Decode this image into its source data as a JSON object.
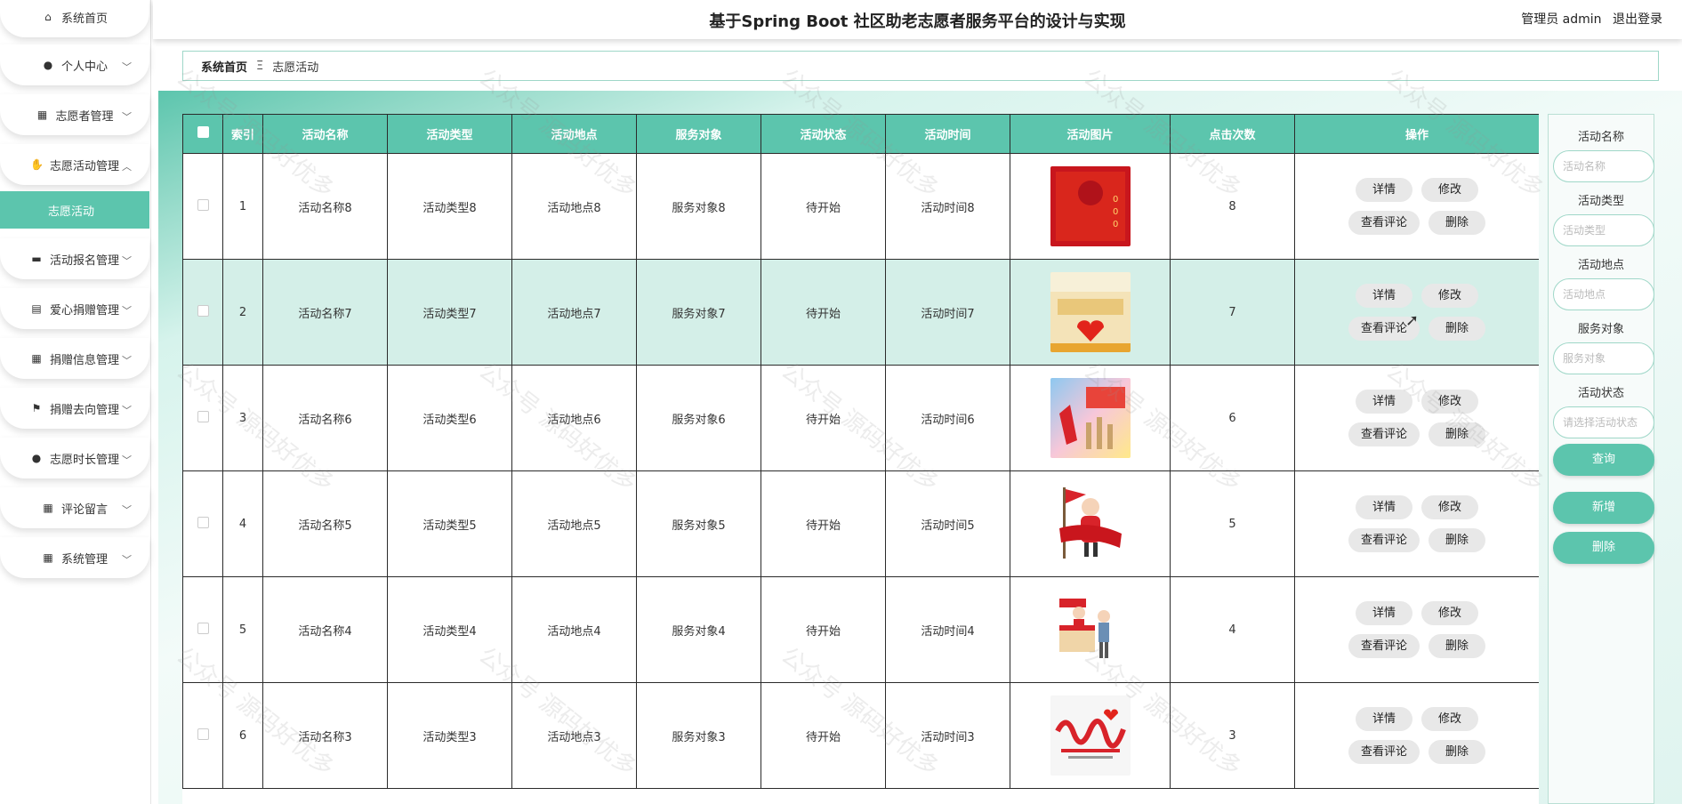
{
  "header": {
    "title": "基于Spring Boot 社区助老志愿者服务平台的设计与实现",
    "role": "管理员 admin",
    "logout": "退出登录"
  },
  "sidebar": {
    "items": [
      {
        "label": "系统首页",
        "icon": "home-icon",
        "chevron": false
      },
      {
        "label": "个人中心",
        "icon": "person-icon",
        "chevron": true
      },
      {
        "label": "志愿者管理",
        "icon": "grid-icon",
        "chevron": true
      },
      {
        "label": "志愿活动管理",
        "icon": "thumb-icon",
        "chevron": true,
        "open": true
      },
      {
        "label": "活动报名管理",
        "icon": "briefcase-icon",
        "chevron": true
      },
      {
        "label": "爱心捐赠管理",
        "icon": "clipboard-icon",
        "chevron": true
      },
      {
        "label": "捐赠信息管理",
        "icon": "grid-icon",
        "chevron": true
      },
      {
        "label": "捐赠去向管理",
        "icon": "flag-icon",
        "chevron": true
      },
      {
        "label": "志愿时长管理",
        "icon": "person-icon",
        "chevron": true
      },
      {
        "label": "评论留言",
        "icon": "grid-icon",
        "chevron": true
      },
      {
        "label": "系统管理",
        "icon": "grid-icon",
        "chevron": true
      }
    ],
    "sub_active": "志愿活动"
  },
  "breadcrumb": {
    "home": "系统首页",
    "sep": "Ξ",
    "current": "志愿活动"
  },
  "table": {
    "headers": [
      "索引",
      "活动名称",
      "活动类型",
      "活动地点",
      "服务对象",
      "活动状态",
      "活动时间",
      "活动图片",
      "点击次数",
      "操作"
    ],
    "ops": {
      "detail": "详情",
      "edit": "修改",
      "comments": "查看评论",
      "delete": "删除"
    },
    "rows": [
      {
        "index": "1",
        "name": "活动名称8",
        "type": "活动类型8",
        "place": "活动地点8",
        "target": "服务对象8",
        "status": "待开始",
        "time": "活动时间8",
        "clicks": "8"
      },
      {
        "index": "2",
        "name": "活动名称7",
        "type": "活动类型7",
        "place": "活动地点7",
        "target": "服务对象7",
        "status": "待开始",
        "time": "活动时间7",
        "clicks": "7"
      },
      {
        "index": "3",
        "name": "活动名称6",
        "type": "活动类型6",
        "place": "活动地点6",
        "target": "服务对象6",
        "status": "待开始",
        "time": "活动时间6",
        "clicks": "6"
      },
      {
        "index": "4",
        "name": "活动名称5",
        "type": "活动类型5",
        "place": "活动地点5",
        "target": "服务对象5",
        "status": "待开始",
        "time": "活动时间5",
        "clicks": "5"
      },
      {
        "index": "5",
        "name": "活动名称4",
        "type": "活动类型4",
        "place": "活动地点4",
        "target": "服务对象4",
        "status": "待开始",
        "time": "活动时间4",
        "clicks": "4"
      },
      {
        "index": "6",
        "name": "活动名称3",
        "type": "活动类型3",
        "place": "活动地点3",
        "target": "服务对象3",
        "status": "待开始",
        "time": "活动时间3",
        "clicks": "3"
      }
    ]
  },
  "search": {
    "name_label": "活动名称",
    "name_placeholder": "活动名称",
    "type_label": "活动类型",
    "type_placeholder": "活动类型",
    "place_label": "活动地点",
    "place_placeholder": "活动地点",
    "target_label": "服务对象",
    "target_placeholder": "服务对象",
    "status_label": "活动状态",
    "status_placeholder": "请选择活动状态",
    "query_btn": "查询",
    "add_btn": "新增",
    "delete_btn": "删除"
  },
  "watermark": "公众号 源码好优多",
  "colors": {
    "accent": "#5cc5ad",
    "highlight_row": "#d4efe8"
  }
}
